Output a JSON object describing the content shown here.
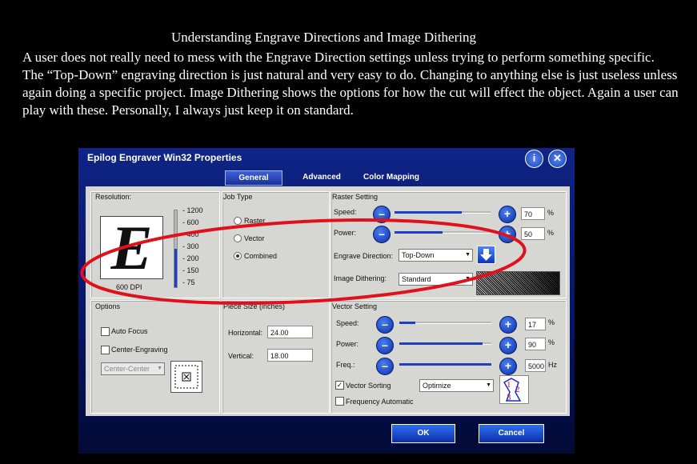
{
  "slide": {
    "title": "Understanding Engrave Directions and Image Dithering",
    "body": "A user does not really need to mess with the Engrave Direction settings unless trying to perform something specific. The “Top-Down” engraving direction is just natural and very easy to do. Changing to anything else is just useless unless again doing a specific project. Image Dithering shows the options for how the cut will effect the object. Again a user can play with these. Personally,  I always just keep it on standard."
  },
  "dialog": {
    "title": "Epilog Engraver Win32 Properties",
    "help_icon": "i",
    "close_icon": "✕",
    "tabs": [
      {
        "label": "General",
        "active": true
      },
      {
        "label": "Advanced",
        "active": false
      },
      {
        "label": "Color Mapping",
        "active": false
      }
    ],
    "resolution": {
      "label": "Resolution:",
      "preview_letter": "E",
      "dpi_label": "600 DPI",
      "ticks": [
        "1200",
        "600",
        "400",
        "300",
        "200",
        "150",
        "75"
      ]
    },
    "job_type": {
      "label": "Job Type",
      "options": [
        {
          "label": "Raster",
          "selected": false
        },
        {
          "label": "Vector",
          "selected": false
        },
        {
          "label": "Combined",
          "selected": true
        }
      ]
    },
    "raster": {
      "label": "Raster Setting",
      "speed_label": "Speed:",
      "speed_value": "70",
      "power_label": "Power:",
      "power_value": "50",
      "percent": "%",
      "engrave_direction_label": "Engrave Direction:",
      "engrave_direction_value": "Top-Down",
      "image_dithering_label": "Image Dithering:",
      "image_dithering_value": "Standard"
    },
    "options": {
      "label": "Options",
      "auto_focus": "Auto Focus",
      "center_engraving": "Center-Engraving",
      "center_select": "Center-Center"
    },
    "piece_size": {
      "label": "Piece Size (inches)",
      "horizontal_label": "Horizontal:",
      "horizontal_value": "24.00",
      "vertical_label": "Vertical:",
      "vertical_value": "18.00"
    },
    "vector": {
      "label": "Vector Setting",
      "speed_label": "Speed:",
      "speed_value": "17",
      "power_label": "Power:",
      "power_value": "90",
      "freq_label": "Freq.:",
      "freq_value": "5000",
      "percent": "%",
      "hz": "Hz",
      "vector_sorting_label": "Vector Sorting",
      "vector_sorting_checked": true,
      "sorting_value": "Optimize",
      "frequency_automatic_label": "Frequency Automatic",
      "frequency_automatic_checked": false,
      "sort_icon_digits": [
        "1",
        "2",
        "3"
      ]
    },
    "ok_label": "OK",
    "cancel_label": "Cancel"
  },
  "slider_levels": {
    "raster_speed": 0.7,
    "raster_power": 0.5,
    "vector_speed": 0.17,
    "vector_power": 0.9,
    "vector_freq": 1.0,
    "resolution": 0.5
  },
  "colors": {
    "dialog_bg": "#071460",
    "button_blue": "#1d3fc6",
    "highlight_ellipse": "#e0101c"
  }
}
